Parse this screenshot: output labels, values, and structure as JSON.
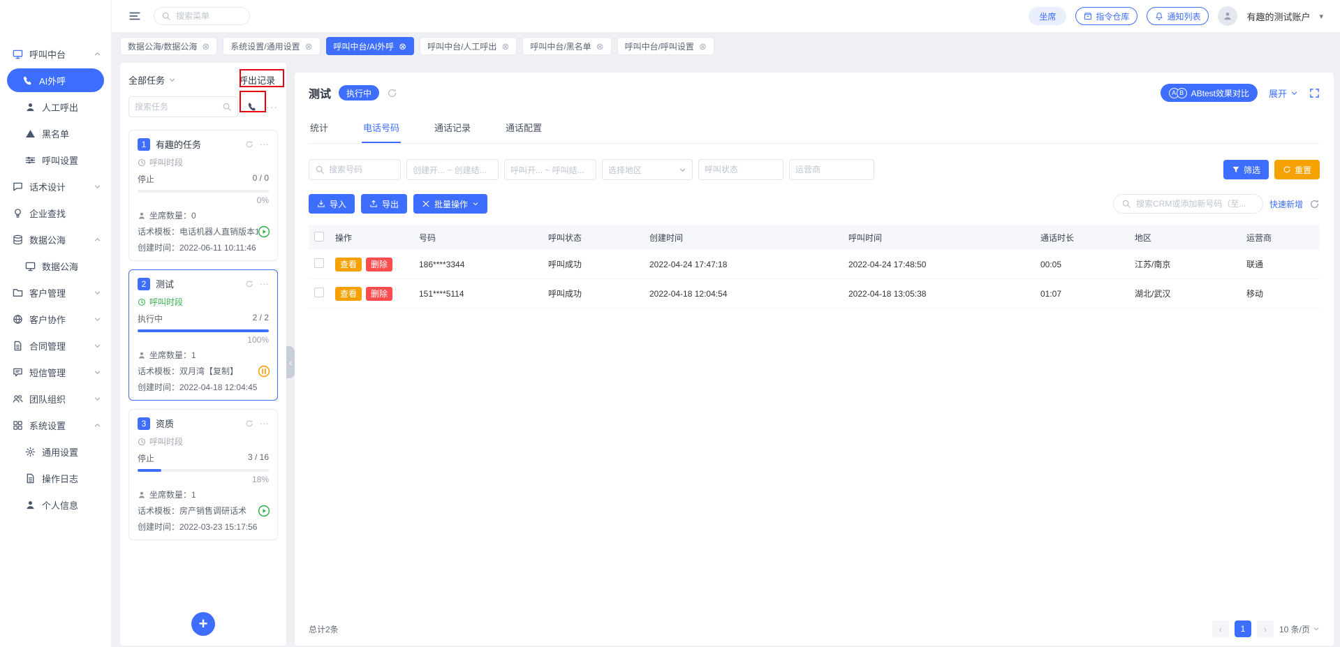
{
  "colors": {
    "accent": "#3d6eff",
    "orange": "#f5a200",
    "red": "#ff4d4f",
    "green": "#37b24d",
    "annotation_red": "#e60012"
  },
  "topbar": {
    "menu_search_placeholder": "搜索菜单",
    "agent_button": "坐席",
    "command_repo_button": "指令仓库",
    "notification_button": "通知列表",
    "username": "有趣的测试账户"
  },
  "workspace_tabs": [
    {
      "label": "数据公海/数据公海"
    },
    {
      "label": "系统设置/通用设置"
    },
    {
      "label": "呼叫中台/AI外呼"
    },
    {
      "label": "呼叫中台/人工呼出"
    },
    {
      "label": "呼叫中台/黑名单"
    },
    {
      "label": "呼叫中台/呼叫设置"
    }
  ],
  "sidebar": {
    "items": [
      {
        "label": "呼叫中台"
      },
      {
        "label": "AI外呼"
      },
      {
        "label": "人工呼出"
      },
      {
        "label": "黑名单"
      },
      {
        "label": "呼叫设置"
      },
      {
        "label": "话术设计"
      },
      {
        "label": "企业查找"
      },
      {
        "label": "数据公海"
      },
      {
        "label": "数据公海"
      },
      {
        "label": "客户管理"
      },
      {
        "label": "客户协作"
      },
      {
        "label": "合同管理"
      },
      {
        "label": "短信管理"
      },
      {
        "label": "团队组织"
      },
      {
        "label": "系统设置"
      },
      {
        "label": "通用设置"
      },
      {
        "label": "操作日志"
      },
      {
        "label": "个人信息"
      }
    ]
  },
  "task_panel": {
    "filter_label": "全部任务",
    "outbound_record_label": "呼出记录",
    "search_placeholder": "搜索任务",
    "tasks": [
      {
        "index": "1",
        "name": "有趣的任务",
        "period": "呼叫时段",
        "status": "停止",
        "ratio": "0 / 0",
        "percent_label": "0%",
        "percent": 0,
        "agents": "坐席数量：0",
        "template": "话术模板：电话机器人直销版本1...",
        "created": "创建时间：2022-06-11 10:11:46"
      },
      {
        "index": "2",
        "name": "测试",
        "period": "呼叫时段",
        "status": "执行中",
        "ratio": "2 / 2",
        "percent_label": "100%",
        "percent": 100,
        "agents": "坐席数量：1",
        "template": "话术模板：双月湾【复制】",
        "created": "创建时间：2022-04-18 12:04:45"
      },
      {
        "index": "3",
        "name": "资质",
        "period": "呼叫时段",
        "status": "停止",
        "ratio": "3 / 16",
        "percent_label": "18%",
        "percent": 18,
        "agents": "坐席数量：1",
        "template": "话术模板：房产销售调研话术",
        "created": "创建时间：2022-03-23 15:17:56"
      }
    ]
  },
  "main": {
    "title": "测试",
    "status_badge": "执行中",
    "abtest_letters": [
      "A",
      "B"
    ],
    "abtest_label": "ABtest效果对比",
    "expand_label": "展开",
    "tabs": [
      {
        "label": "统计"
      },
      {
        "label": "电话号码"
      },
      {
        "label": "通话记录"
      },
      {
        "label": "通话配置"
      }
    ],
    "filters": {
      "search_number": "搜索号码",
      "create_range": "创建开... ~ 创建结...",
      "call_range": "呼叫开... ~ 呼叫结...",
      "region": "选择地区",
      "call_status": "呼叫状态",
      "operator": "运营商",
      "filter_button": "筛选",
      "reset_button": "重置"
    },
    "actions": {
      "import": "导入",
      "export": "导出",
      "batch": "批量操作",
      "crm_search_placeholder": "搜索CRM或添加新号码（至...",
      "quick_add": "快速新增"
    },
    "table": {
      "headers": [
        "操作",
        "号码",
        "呼叫状态",
        "创建时间",
        "呼叫时间",
        "通话时长",
        "地区",
        "运营商"
      ],
      "view_label": "查看",
      "delete_label": "删除",
      "rows": [
        {
          "number": "186****3344",
          "status": "呼叫成功",
          "created": "2022-04-24 17:47:18",
          "call_time": "2022-04-24 17:48:50",
          "duration": "00:05",
          "region": "江苏/南京",
          "operator": "联通"
        },
        {
          "number": "151****5114",
          "status": "呼叫成功",
          "created": "2022-04-18 12:04:54",
          "call_time": "2022-04-18 13:05:38",
          "duration": "01:07",
          "region": "湖北/武汉",
          "operator": "移动"
        }
      ]
    },
    "footer": {
      "total": "总计2条",
      "page": "1",
      "page_size": "10 条/页"
    }
  }
}
